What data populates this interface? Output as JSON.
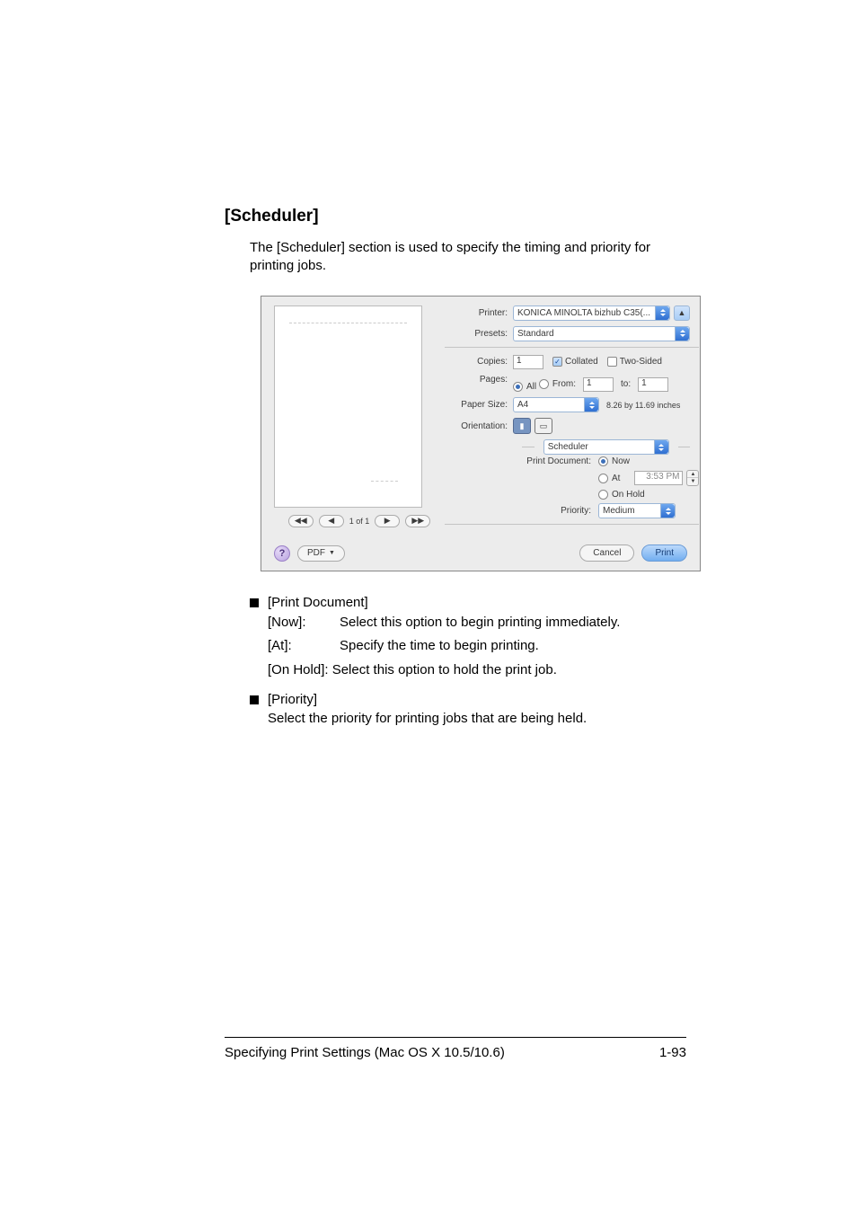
{
  "heading": "[Scheduler]",
  "intro": "The [Scheduler] section is used to specify the timing and priority for printing jobs.",
  "dialog": {
    "printer_label": "Printer:",
    "printer_value": "KONICA MINOLTA bizhub C35(...",
    "presets_label": "Presets:",
    "presets_value": "Standard",
    "copies_label": "Copies:",
    "copies_value": "1",
    "collated_label": "Collated",
    "two_sided_label": "Two-Sided",
    "pages_label": "Pages:",
    "pages_all_label": "All",
    "pages_from_label": "From:",
    "pages_from_value": "1",
    "pages_to_label": "to:",
    "pages_to_value": "1",
    "paper_size_label": "Paper Size:",
    "paper_size_value": "A4",
    "paper_size_meta": "8.26 by 11.69 inches",
    "orientation_label": "Orientation:",
    "section_value": "Scheduler",
    "print_document_label": "Print Document:",
    "opt_now_label": "Now",
    "opt_at_label": "At",
    "at_time_value": "3:53 PM",
    "opt_onhold_label": "On Hold",
    "priority_label": "Priority:",
    "priority_value": "Medium",
    "pager_value": "1 of 1",
    "pager_first": "◀◀",
    "pager_prev": "◀",
    "pager_next": "▶",
    "pager_last": "▶▶",
    "help_glyph": "?",
    "status_glyph": "▲",
    "pdf_label": "PDF",
    "cancel_label": "Cancel",
    "print_label": "Print"
  },
  "desc": {
    "b1_title": "[Print Document]",
    "now_key": "[Now]:",
    "now_val": "Select this option to begin printing immediately.",
    "at_key": "[At]:",
    "at_val": "Specify the time to begin printing.",
    "onhold_line": "[On Hold]: Select this option to hold the print job.",
    "b2_title": "[Priority]",
    "b2_text": "Select the priority for printing jobs that are being held."
  },
  "footer": {
    "left": "Specifying Print Settings (Mac OS X 10.5/10.6)",
    "right": "1-93"
  }
}
